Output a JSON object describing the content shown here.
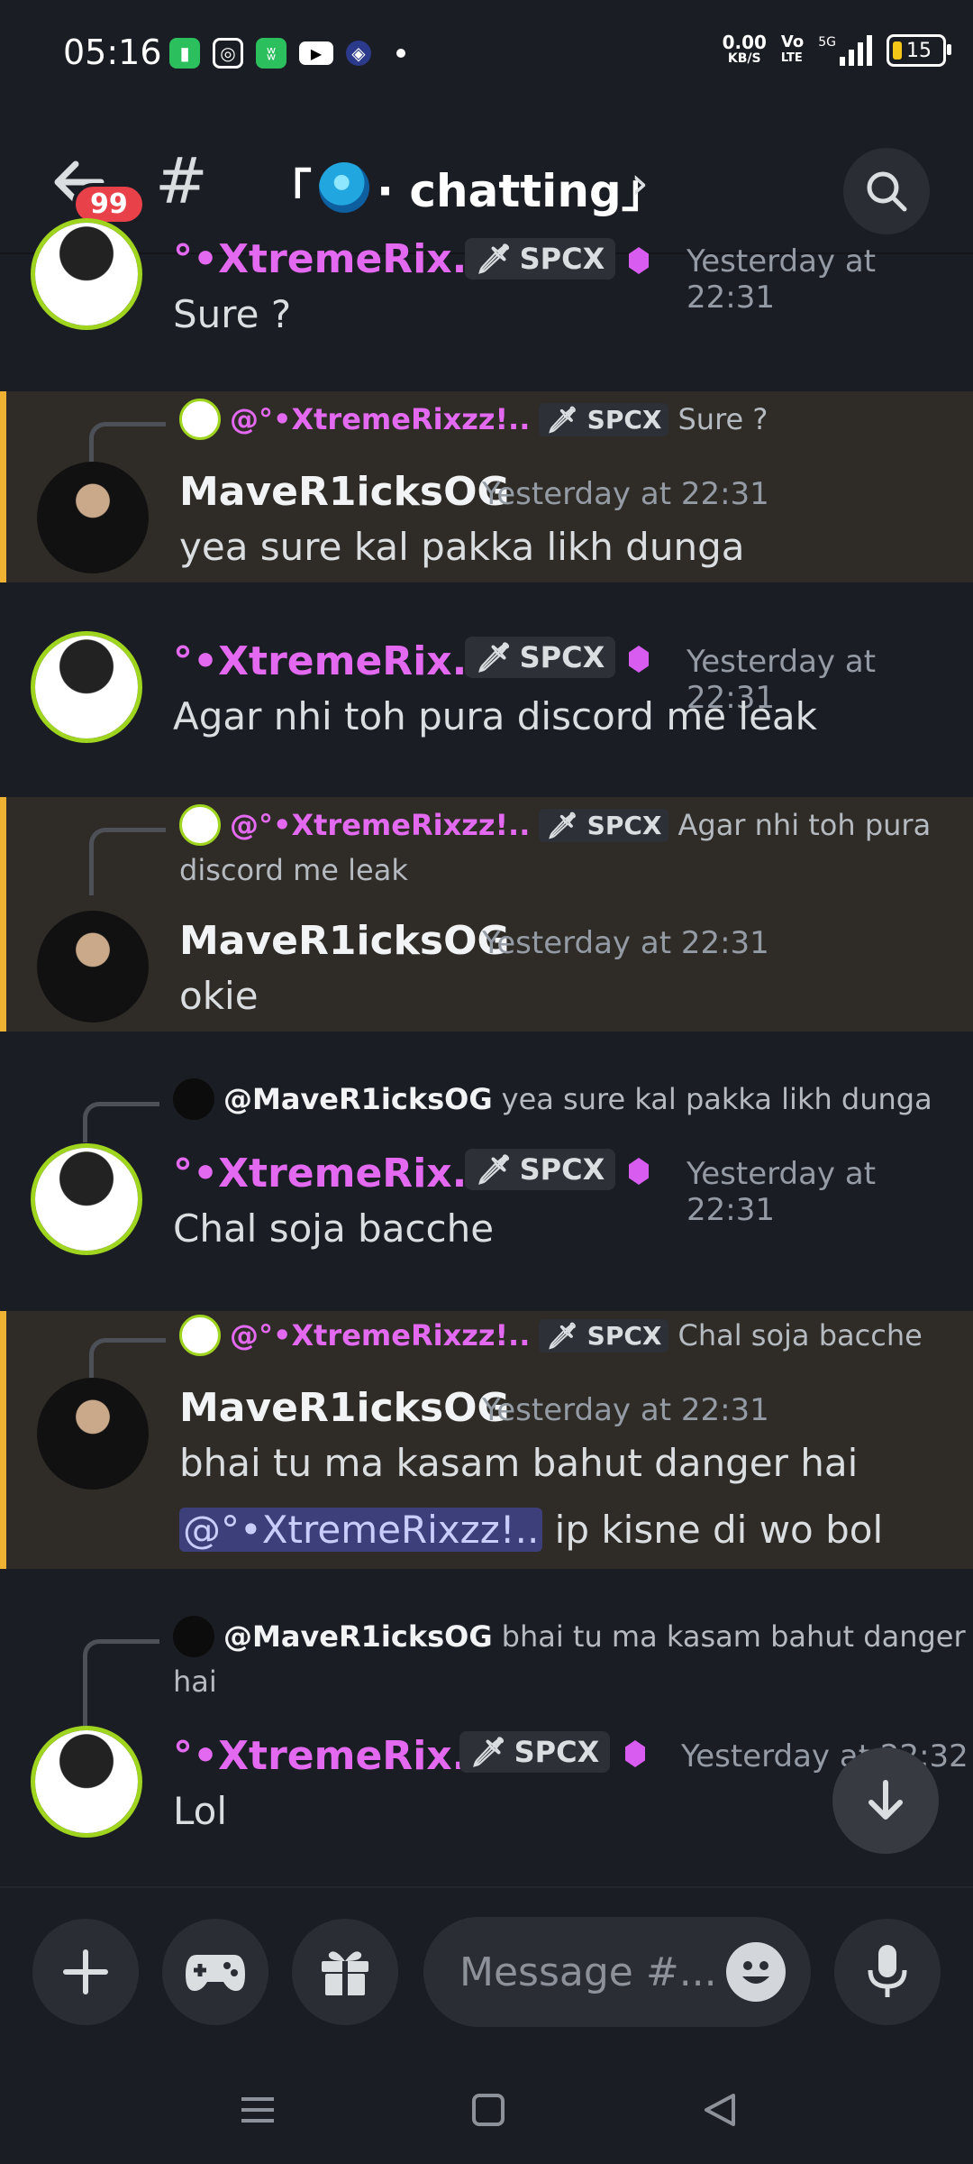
{
  "status_bar": {
    "time": "05:16",
    "speed_value": "0.00",
    "speed_unit": "KB/S",
    "volte_top": "Vo",
    "volte_bottom": "LTE",
    "network": "5G",
    "battery": "15",
    "app_icons": [
      "battery-saver-icon",
      "instagram-icon",
      "app-icon",
      "youtube-icon",
      "shield-app-icon"
    ]
  },
  "header": {
    "unread_badge": "99",
    "channel_prefix": "「",
    "channel_name": "· chatting」"
  },
  "tag": "SPCX",
  "messages": [
    {
      "author": "°•XtremeRix...",
      "time": "Yesterday at 22:31",
      "text": "Sure ?"
    },
    {
      "reply_author": "@°•XtremeRixzz!..",
      "reply_text": "Sure ?",
      "author": "MaveR1icksOG",
      "time": "Yesterday at 22:31",
      "text": "yea sure kal pakka likh dunga"
    },
    {
      "author": "°•XtremeRix...",
      "time": "Yesterday at 22:31",
      "text": "Agar nhi toh pura discord me leak"
    },
    {
      "reply_author": "@°•XtremeRixzz!..",
      "reply_text_1": "Agar nhi toh pura",
      "reply_text_2": "discord me leak",
      "author": "MaveR1icksOG",
      "time": "Yesterday at 22:31",
      "text": "okie"
    },
    {
      "reply_author": "@MaveR1icksOG",
      "reply_text": "yea sure kal pakka likh dunga",
      "author": "°•XtremeRix...",
      "time": "Yesterday at 22:31",
      "text": "Chal soja bacche"
    },
    {
      "reply_author": "@°•XtremeRixzz!..",
      "reply_text": "Chal soja bacche",
      "author": "MaveR1icksOG",
      "time": "Yesterday at 22:31",
      "text_line1": "bhai tu ma kasam bahut danger hai",
      "mention": "@°•XtremeRixzz!..",
      "text_line2": " ip kisne di wo bol"
    },
    {
      "reply_author": "@MaveR1icksOG",
      "reply_text_1": "bhai tu ma kasam bahut danger",
      "reply_text_2": "hai",
      "author": "°•XtremeRix...",
      "time": "Yesterday at 22:32",
      "text": "Lol"
    }
  ],
  "composer": {
    "placeholder": "Message #..."
  }
}
